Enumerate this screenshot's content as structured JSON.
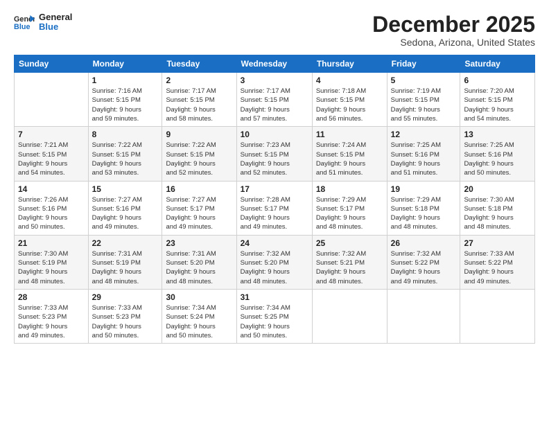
{
  "logo": {
    "line1": "General",
    "line2": "Blue"
  },
  "title": "December 2025",
  "subtitle": "Sedona, Arizona, United States",
  "days_header": [
    "Sunday",
    "Monday",
    "Tuesday",
    "Wednesday",
    "Thursday",
    "Friday",
    "Saturday"
  ],
  "weeks": [
    [
      {
        "day": "",
        "info": ""
      },
      {
        "day": "1",
        "info": "Sunrise: 7:16 AM\nSunset: 5:15 PM\nDaylight: 9 hours\nand 59 minutes."
      },
      {
        "day": "2",
        "info": "Sunrise: 7:17 AM\nSunset: 5:15 PM\nDaylight: 9 hours\nand 58 minutes."
      },
      {
        "day": "3",
        "info": "Sunrise: 7:17 AM\nSunset: 5:15 PM\nDaylight: 9 hours\nand 57 minutes."
      },
      {
        "day": "4",
        "info": "Sunrise: 7:18 AM\nSunset: 5:15 PM\nDaylight: 9 hours\nand 56 minutes."
      },
      {
        "day": "5",
        "info": "Sunrise: 7:19 AM\nSunset: 5:15 PM\nDaylight: 9 hours\nand 55 minutes."
      },
      {
        "day": "6",
        "info": "Sunrise: 7:20 AM\nSunset: 5:15 PM\nDaylight: 9 hours\nand 54 minutes."
      }
    ],
    [
      {
        "day": "7",
        "info": "Sunrise: 7:21 AM\nSunset: 5:15 PM\nDaylight: 9 hours\nand 54 minutes."
      },
      {
        "day": "8",
        "info": "Sunrise: 7:22 AM\nSunset: 5:15 PM\nDaylight: 9 hours\nand 53 minutes."
      },
      {
        "day": "9",
        "info": "Sunrise: 7:22 AM\nSunset: 5:15 PM\nDaylight: 9 hours\nand 52 minutes."
      },
      {
        "day": "10",
        "info": "Sunrise: 7:23 AM\nSunset: 5:15 PM\nDaylight: 9 hours\nand 52 minutes."
      },
      {
        "day": "11",
        "info": "Sunrise: 7:24 AM\nSunset: 5:15 PM\nDaylight: 9 hours\nand 51 minutes."
      },
      {
        "day": "12",
        "info": "Sunrise: 7:25 AM\nSunset: 5:16 PM\nDaylight: 9 hours\nand 51 minutes."
      },
      {
        "day": "13",
        "info": "Sunrise: 7:25 AM\nSunset: 5:16 PM\nDaylight: 9 hours\nand 50 minutes."
      }
    ],
    [
      {
        "day": "14",
        "info": "Sunrise: 7:26 AM\nSunset: 5:16 PM\nDaylight: 9 hours\nand 50 minutes."
      },
      {
        "day": "15",
        "info": "Sunrise: 7:27 AM\nSunset: 5:16 PM\nDaylight: 9 hours\nand 49 minutes."
      },
      {
        "day": "16",
        "info": "Sunrise: 7:27 AM\nSunset: 5:17 PM\nDaylight: 9 hours\nand 49 minutes."
      },
      {
        "day": "17",
        "info": "Sunrise: 7:28 AM\nSunset: 5:17 PM\nDaylight: 9 hours\nand 49 minutes."
      },
      {
        "day": "18",
        "info": "Sunrise: 7:29 AM\nSunset: 5:17 PM\nDaylight: 9 hours\nand 48 minutes."
      },
      {
        "day": "19",
        "info": "Sunrise: 7:29 AM\nSunset: 5:18 PM\nDaylight: 9 hours\nand 48 minutes."
      },
      {
        "day": "20",
        "info": "Sunrise: 7:30 AM\nSunset: 5:18 PM\nDaylight: 9 hours\nand 48 minutes."
      }
    ],
    [
      {
        "day": "21",
        "info": "Sunrise: 7:30 AM\nSunset: 5:19 PM\nDaylight: 9 hours\nand 48 minutes."
      },
      {
        "day": "22",
        "info": "Sunrise: 7:31 AM\nSunset: 5:19 PM\nDaylight: 9 hours\nand 48 minutes."
      },
      {
        "day": "23",
        "info": "Sunrise: 7:31 AM\nSunset: 5:20 PM\nDaylight: 9 hours\nand 48 minutes."
      },
      {
        "day": "24",
        "info": "Sunrise: 7:32 AM\nSunset: 5:20 PM\nDaylight: 9 hours\nand 48 minutes."
      },
      {
        "day": "25",
        "info": "Sunrise: 7:32 AM\nSunset: 5:21 PM\nDaylight: 9 hours\nand 48 minutes."
      },
      {
        "day": "26",
        "info": "Sunrise: 7:32 AM\nSunset: 5:22 PM\nDaylight: 9 hours\nand 49 minutes."
      },
      {
        "day": "27",
        "info": "Sunrise: 7:33 AM\nSunset: 5:22 PM\nDaylight: 9 hours\nand 49 minutes."
      }
    ],
    [
      {
        "day": "28",
        "info": "Sunrise: 7:33 AM\nSunset: 5:23 PM\nDaylight: 9 hours\nand 49 minutes."
      },
      {
        "day": "29",
        "info": "Sunrise: 7:33 AM\nSunset: 5:23 PM\nDaylight: 9 hours\nand 50 minutes."
      },
      {
        "day": "30",
        "info": "Sunrise: 7:34 AM\nSunset: 5:24 PM\nDaylight: 9 hours\nand 50 minutes."
      },
      {
        "day": "31",
        "info": "Sunrise: 7:34 AM\nSunset: 5:25 PM\nDaylight: 9 hours\nand 50 minutes."
      },
      {
        "day": "",
        "info": ""
      },
      {
        "day": "",
        "info": ""
      },
      {
        "day": "",
        "info": ""
      }
    ]
  ]
}
